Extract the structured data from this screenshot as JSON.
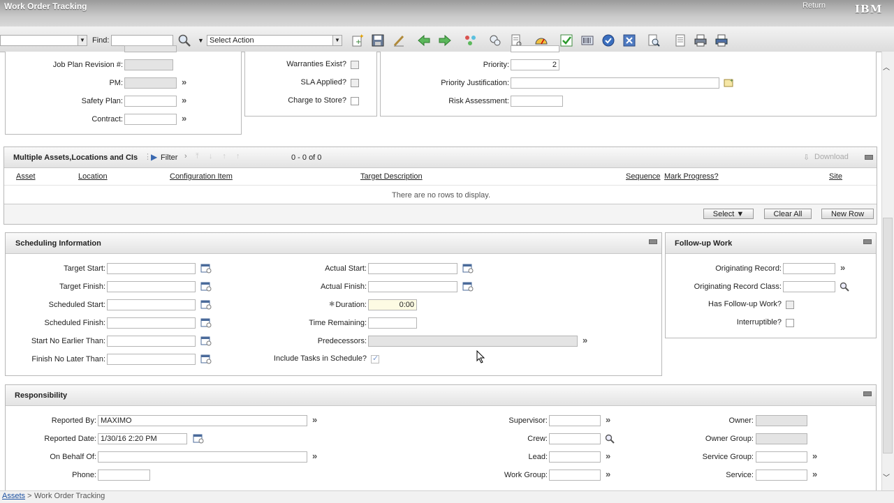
{
  "app": {
    "title": "Work Order Tracking",
    "return_label": "Return",
    "brand": "IBM"
  },
  "toolbar": {
    "find_label": "Find:",
    "find_value": "",
    "select_action": "Select Action",
    "icons": [
      "new-record-icon",
      "save-icon",
      "clear-changes-icon",
      "previous-record-icon",
      "next-record-icon",
      "route-workflow-icon",
      "view-related-icon",
      "report-icon",
      "gauge-icon",
      "approve-icon",
      "barcode-icon",
      "complete-icon",
      "cancel-icon",
      "search-doc-icon",
      "list-icon",
      "print-icon",
      "print-attachments-icon"
    ]
  },
  "top_left": {
    "job_plan_revision": "Job Plan Revision #:",
    "pm": "PM:",
    "safety_plan": "Safety Plan:",
    "contract": "Contract:"
  },
  "top_mid": {
    "warranties": "Warranties Exist?",
    "sla": "SLA Applied?",
    "charge_store": "Charge to Store?"
  },
  "top_right": {
    "priority_label": "Priority:",
    "priority_value": "2",
    "priority_justification": "Priority Justification:",
    "risk_assessment": "Risk Assessment:"
  },
  "multi_assets": {
    "title": "Multiple Assets,Locations and CIs",
    "filter": "Filter",
    "count": "0 - 0 of 0",
    "download": "Download",
    "columns": [
      "Asset",
      "Location",
      "Configuration Item",
      "Target Description",
      "Sequence",
      "Mark Progress?",
      "Site"
    ],
    "empty": "There are no rows to display.",
    "buttons": {
      "select": "Select",
      "clear_all": "Clear All",
      "new_row": "New Row"
    }
  },
  "scheduling": {
    "title": "Scheduling Information",
    "left": [
      "Target Start:",
      "Target Finish:",
      "Scheduled Start:",
      "Scheduled Finish:",
      "Start No Earlier Than:",
      "Finish No Later Than:"
    ],
    "actual_start": "Actual Start:",
    "actual_finish": "Actual Finish:",
    "duration_label": "Duration:",
    "duration_value": "0:00",
    "time_remaining": "Time Remaining:",
    "predecessors": "Predecessors:",
    "include_tasks": "Include Tasks in Schedule?",
    "include_tasks_checked": true
  },
  "followup": {
    "title": "Follow-up Work",
    "originating_record": "Originating Record:",
    "originating_record_class": "Originating Record Class:",
    "has_followup": "Has Follow-up Work?",
    "interruptible": "Interruptible?"
  },
  "responsibility": {
    "title": "Responsibility",
    "reported_by_label": "Reported By:",
    "reported_by_value": "MAXIMO",
    "reported_date_label": "Reported Date:",
    "reported_date_value": "1/30/16 2:20 PM",
    "on_behalf_of": "On Behalf Of:",
    "phone": "Phone:",
    "supervisor": "Supervisor:",
    "crew": "Crew:",
    "lead": "Lead:",
    "work_group": "Work Group:",
    "owner": "Owner:",
    "owner_group": "Owner Group:",
    "service_group": "Service Group:",
    "service": "Service:"
  },
  "breadcrumb": {
    "root": "Assets",
    "separator": ">",
    "current": "Work Order Tracking"
  }
}
